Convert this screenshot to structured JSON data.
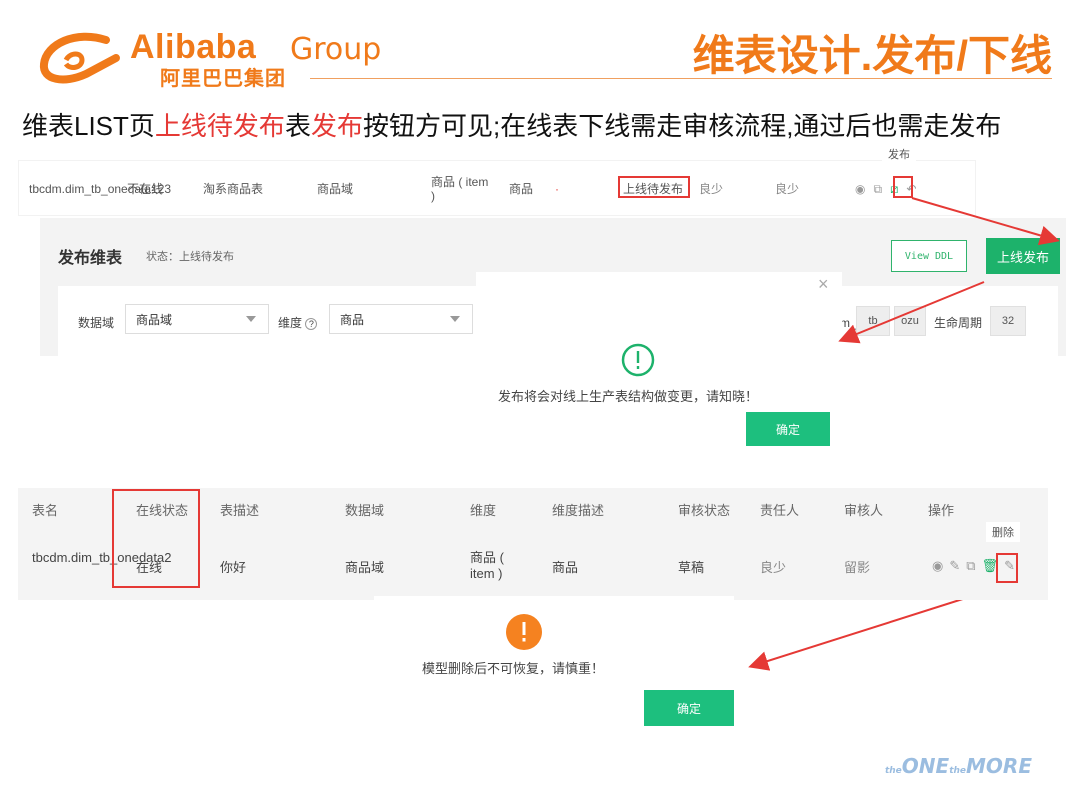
{
  "header": {
    "logo_name": "Alibaba",
    "logo_group": "Group",
    "logo_cn": "阿里巴巴集团",
    "slide_title": "维表设计.发布/下线",
    "accent_color": "#f07a1a"
  },
  "subtitle": {
    "p1": "维表LIST页",
    "p2": "上线待发布",
    "p3": "表",
    "p4": "发布",
    "p5": "按钮方可见;在线表下线需走审核流程,通过后也需走发布"
  },
  "row1": {
    "table_name": "tbcdm.dim_tb_onedata123",
    "online_status": "不在线",
    "description": "淘系商品表",
    "domain": "商品域",
    "dimension": "商品 ( item )",
    "dimension_desc": "商品",
    "dot": "·",
    "audit_status": "上线待发布",
    "owner": "良少",
    "reviewer": "良少",
    "publish_tooltip": "发布"
  },
  "publish_dialog": {
    "title": "发布维表",
    "status": "状态：上线待发布",
    "view_ddl_label": "View DDL",
    "publish_btn_label": "上线发布",
    "domain_label": "数据域",
    "domain_value": "商品域",
    "dim_label": "维度",
    "dim_value": "商品",
    "name_prefix": "m_",
    "name_mid": "tb",
    "name_suffix": "ozu",
    "lifecycle_label": "生命周期",
    "lifecycle_value": "32"
  },
  "confirm1": {
    "message": "发布将会对线上生产表结构做变更，请知晓！",
    "ok_label": "确定",
    "close_icon": "close-icon"
  },
  "table2": {
    "headers": [
      "表名",
      "在线状态",
      "表描述",
      "数据域",
      "维度",
      "维度描述",
      "审核状态",
      "责任人",
      "审核人",
      "操作"
    ],
    "row": {
      "table_name": "tbcdm.dim_tb_onedata2",
      "online_status": "在线",
      "description": "你好",
      "domain": "商品域",
      "dimension": "商品 ( item )",
      "dimension_desc": "商品",
      "audit_status": "草稿",
      "owner": "良少",
      "reviewer": "留影"
    },
    "delete_tooltip": "删除"
  },
  "confirm2": {
    "message": "模型删除后不可恢复，请慎重！",
    "ok_label": "确定"
  },
  "footer": {
    "the1": "the",
    "one": "ONE",
    "the2": "the",
    "more": "MORE"
  }
}
